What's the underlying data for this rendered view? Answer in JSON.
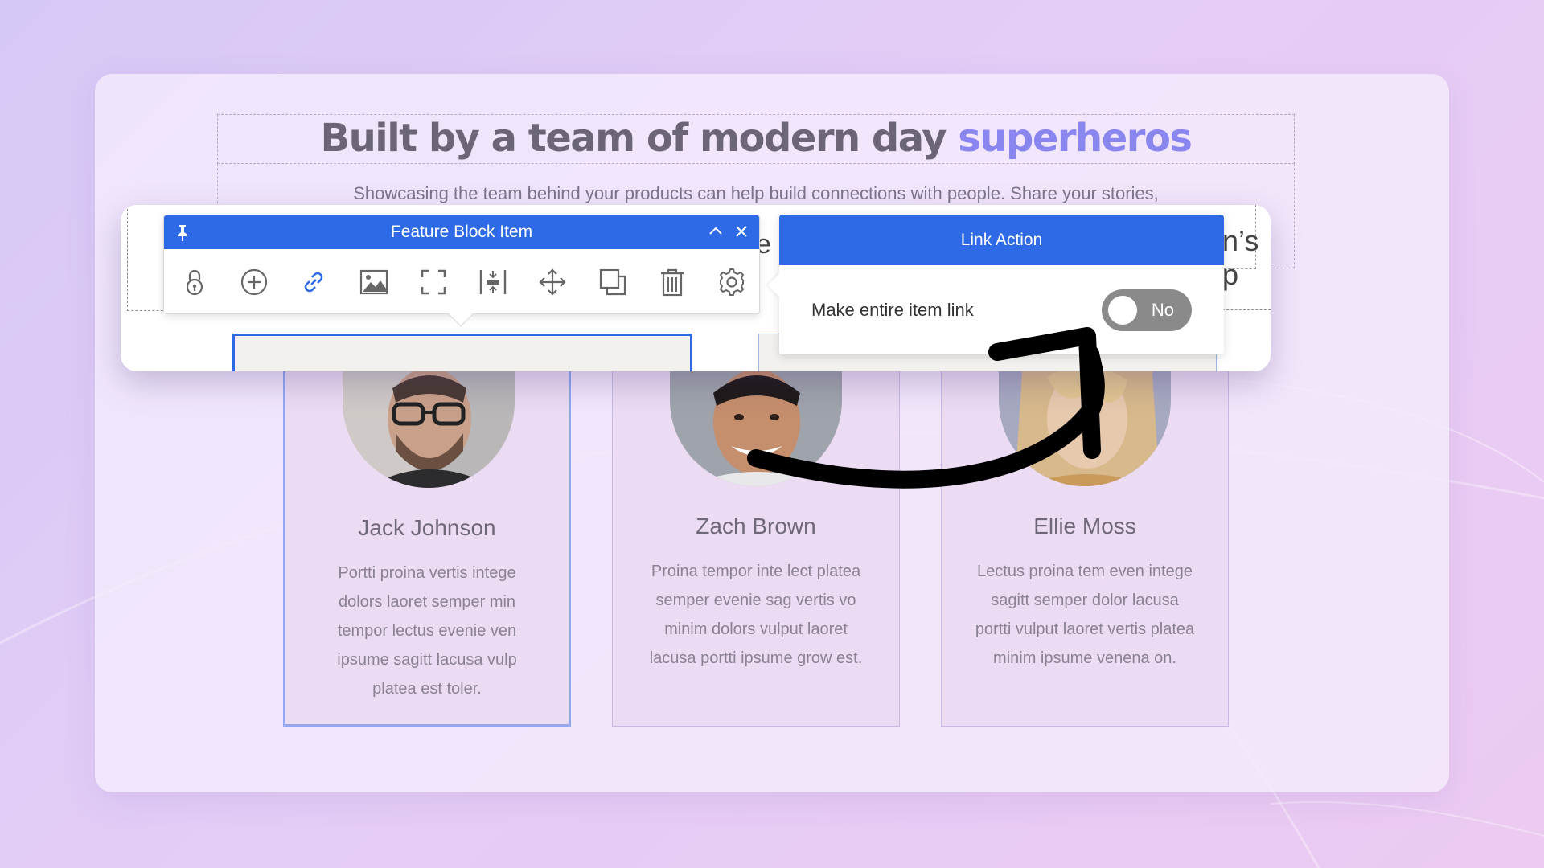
{
  "section": {
    "heading_main": "Built by a team of modern day",
    "heading_accent": "superheros",
    "subtext": "Showcasing the team behind your products can help build connections with people. Share your stories,"
  },
  "overlay_peek": {
    "left_letter": "e",
    "right_letters": "n’s p"
  },
  "toolbar": {
    "title": "Feature Block Item",
    "tools": [
      "lock",
      "add",
      "link",
      "image",
      "fullscreen",
      "spacing",
      "move",
      "duplicate",
      "delete",
      "settings"
    ]
  },
  "link_panel": {
    "title": "Link Action",
    "label": "Make entire item link",
    "toggle_state": "No"
  },
  "team": [
    {
      "name": "Jack Johnson",
      "bio": "Portti proina vertis intege dolors laoret semper min tempor lectus evenie ven ipsume sagitt lacusa vulp platea est toler."
    },
    {
      "name": "Zach Brown",
      "bio": "Proina tempor inte lect platea semper evenie sag vertis vo minim dolors vulput laoret lacusa portti ipsume grow est."
    },
    {
      "name": "Ellie Moss",
      "bio": "Lectus proina tem even intege sagitt semper dolor lacusa portti vulput laoret vertis platea minim ipsume venena on."
    }
  ],
  "colors": {
    "accent": "#2e6ae6",
    "heading_accent": "#8a86f0",
    "toggle_off": "#8a8a8a"
  }
}
